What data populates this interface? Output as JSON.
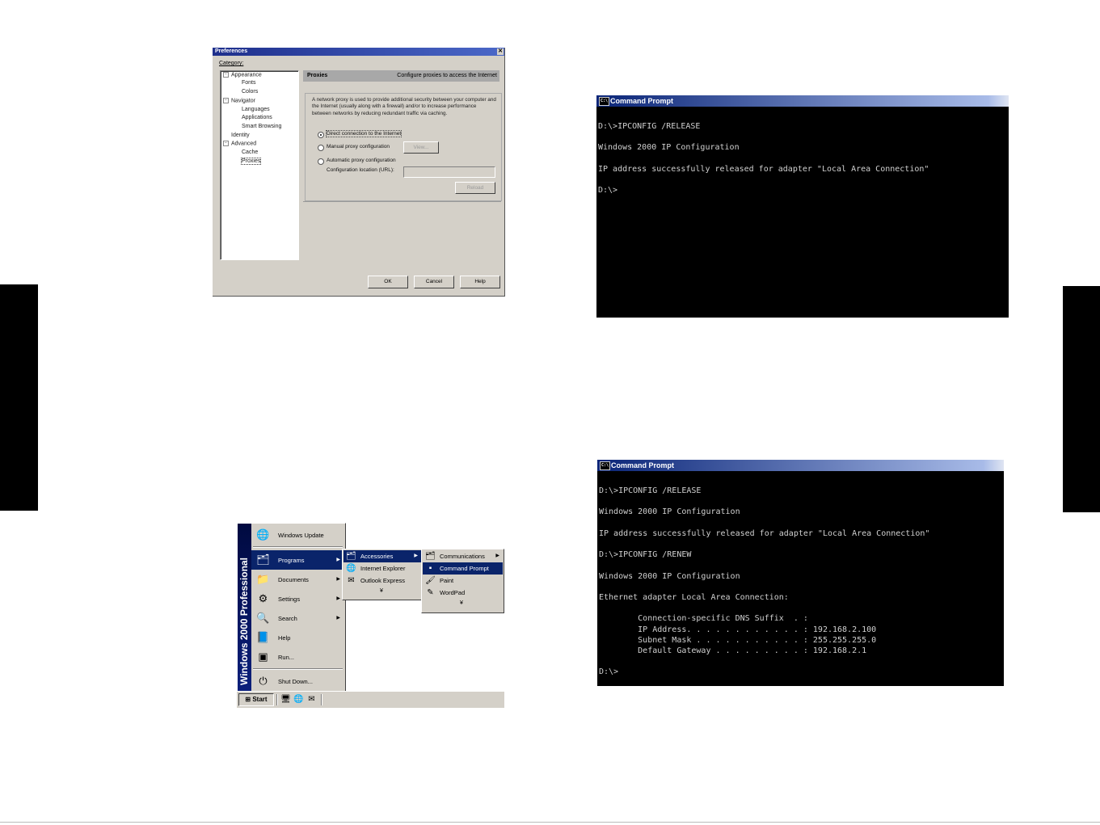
{
  "preferences": {
    "title": "Preferences",
    "close_glyph": "✕",
    "category_label": "Category:",
    "tree": [
      {
        "label": "Appearance",
        "toggle": "−"
      },
      {
        "label": "Fonts"
      },
      {
        "label": "Colors"
      },
      {
        "label": "Navigator",
        "toggle": "−"
      },
      {
        "label": "Languages"
      },
      {
        "label": "Applications"
      },
      {
        "label": "Smart Browsing"
      },
      {
        "label": "Identity"
      },
      {
        "label": "Advanced",
        "toggle": "−"
      },
      {
        "label": "Cache"
      },
      {
        "label": "Proxies",
        "selected": true
      }
    ],
    "panel_title": "Proxies",
    "panel_description": "Configure proxies to access the Internet",
    "body_text": "A network proxy is used to provide additional security between your computer and the Internet (usually along with a firewall) and/or to increase performance between networks by reducing redundant traffic via caching.",
    "options": {
      "direct": "Direct connection to the Internet",
      "manual": "Manual proxy configuration",
      "automatic": "Automatic proxy configuration"
    },
    "view_button": "View...",
    "config_location_label": "Configuration location (URL):",
    "config_location_value": "",
    "reload_button": "Reload",
    "ok_button": "OK",
    "cancel_button": "Cancel",
    "help_button": "Help"
  },
  "cmd1": {
    "title": "Command Prompt",
    "icon_text": "C:\\",
    "lines": "D:\\>IPCONFIG /RELEASE\n\nWindows 2000 IP Configuration\n\nIP address successfully released for adapter \"Local Area Connection\"\n\nD:\\>"
  },
  "cmd2": {
    "title": "Command Prompt",
    "icon_text": "C:\\",
    "lines": "D:\\>IPCONFIG /RELEASE\n\nWindows 2000 IP Configuration\n\nIP address successfully released for adapter \"Local Area Connection\"\n\nD:\\>IPCONFIG /RENEW\n\nWindows 2000 IP Configuration\n\nEthernet adapter Local Area Connection:\n\n        Connection-specific DNS Suffix  . :\n        IP Address. . . . . . . . . . . . : 192.168.2.100\n        Subnet Mask . . . . . . . . . . . : 255.255.255.0\n        Default Gateway . . . . . . . . . : 192.168.2.1\n\nD:\\>"
  },
  "start_menu": {
    "banner": "Windows 2000 Professional",
    "items": [
      {
        "label": "Windows Update",
        "icon": "🌐"
      },
      {
        "label": "Programs",
        "icon": "🗂",
        "arrow": "▶"
      },
      {
        "label": "Documents",
        "icon": "📁",
        "arrow": "▶"
      },
      {
        "label": "Settings",
        "icon": "⚙",
        "arrow": "▶"
      },
      {
        "label": "Search",
        "icon": "🔍",
        "arrow": "▶"
      },
      {
        "label": "Help",
        "icon": "📘"
      },
      {
        "label": "Run...",
        "icon": "▣"
      },
      {
        "label": "Shut Down...",
        "icon": "⏻"
      }
    ],
    "programs_submenu": [
      {
        "label": "Accessories",
        "icon": "🗂",
        "arrow": "▶"
      },
      {
        "label": "Internet Explorer",
        "icon": "🌐"
      },
      {
        "label": "Outlook Express",
        "icon": "✉"
      }
    ],
    "accessories_submenu": [
      {
        "label": "Communications",
        "icon": "🗂",
        "arrow": "▶"
      },
      {
        "label": "Command Prompt",
        "icon": "▪"
      },
      {
        "label": "Paint",
        "icon": "🖌"
      },
      {
        "label": "WordPad",
        "icon": "✎"
      }
    ],
    "more_glyph": "¥",
    "taskbar": {
      "start_label": "Start",
      "start_icon": "⊞",
      "quick_launch": [
        "🖥",
        "🌐",
        "✉"
      ]
    }
  }
}
